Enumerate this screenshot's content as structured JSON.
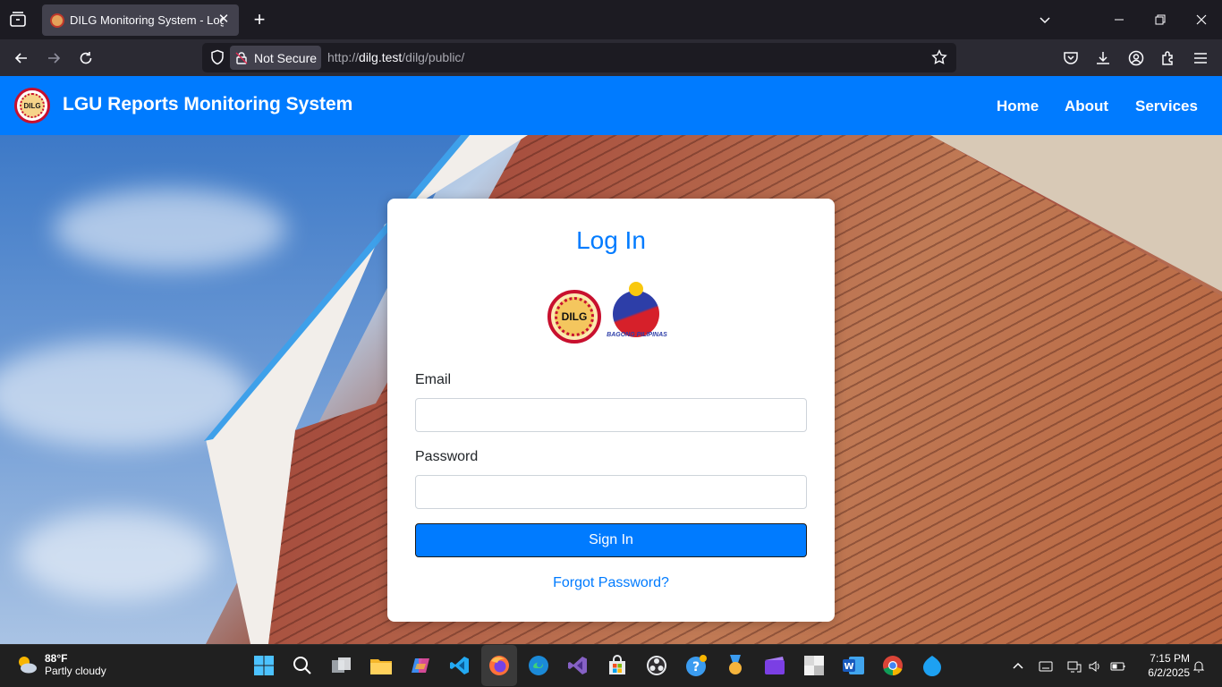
{
  "browser": {
    "tab_title": "DILG Monitoring System - Login",
    "security_label": "Not Secure",
    "url_prefix": "http://",
    "url_host": "dilg.test",
    "url_path": "/dilg/public/"
  },
  "site": {
    "brand_title": "LGU Reports Monitoring System",
    "brand_logo_text": "DILG",
    "nav": [
      "Home",
      "About",
      "Services"
    ]
  },
  "login": {
    "heading": "Log In",
    "dilg_logo_text": "DILG",
    "bp_logo_text": "BAGONG PILIPINAS",
    "email_label": "Email",
    "email_value": "",
    "password_label": "Password",
    "password_value": "",
    "submit_label": "Sign In",
    "forgot_label": "Forgot Password?"
  },
  "taskbar": {
    "temperature": "88°F",
    "weather": "Partly cloudy",
    "time": "7:15 PM",
    "date": "6/2/2025",
    "apps": [
      "start",
      "search",
      "task-view",
      "file-explorer",
      "copilot",
      "vscode",
      "firefox",
      "edge",
      "visual-studio",
      "microsoft-store",
      "obs",
      "tips",
      "badge",
      "clipchamp",
      "blank-app",
      "word",
      "chrome",
      "xampp"
    ]
  }
}
